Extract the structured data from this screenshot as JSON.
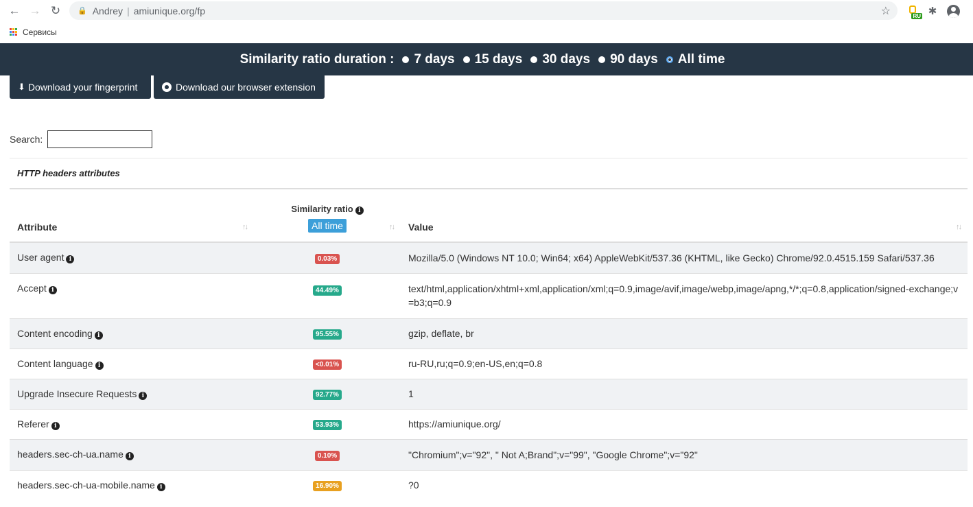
{
  "browser": {
    "profile": "Andrey",
    "url": "amiunique.org/fp",
    "bookmark_label": "Сервисы",
    "ext_badge": "RU"
  },
  "duration": {
    "title": "Similarity ratio duration :",
    "options": [
      {
        "label": "7 days",
        "selected": false
      },
      {
        "label": "15 days",
        "selected": false
      },
      {
        "label": "30 days",
        "selected": false
      },
      {
        "label": "90 days",
        "selected": false
      },
      {
        "label": "All time",
        "selected": true
      }
    ]
  },
  "buttons": {
    "download_fingerprint": "Download your fingerprint",
    "download_extension": "Download our browser extension"
  },
  "search": {
    "label": "Search:",
    "value": ""
  },
  "table": {
    "section_title": "HTTP headers attributes",
    "headers": {
      "attribute": "Attribute",
      "similarity": "Similarity ratio",
      "similarity_period": "All time",
      "value": "Value"
    },
    "rows": [
      {
        "attribute": "User agent",
        "ratio": "0.03%",
        "color": "#d9534f",
        "value": "Mozilla/5.0 (Windows NT 10.0; Win64; x64) AppleWebKit/537.36 (KHTML, like Gecko) Chrome/92.0.4515.159 Safari/537.36"
      },
      {
        "attribute": "Accept",
        "ratio": "44.49%",
        "color": "#26a98b",
        "value": "text/html,application/xhtml+xml,application/xml;q=0.9,image/avif,image/webp,image/apng,*/*;q=0.8,application/signed-exchange;v=b3;q=0.9"
      },
      {
        "attribute": "Content encoding",
        "ratio": "95.55%",
        "color": "#26a98b",
        "value": "gzip, deflate, br"
      },
      {
        "attribute": "Content language",
        "ratio": "<0.01%",
        "color": "#d9534f",
        "value": "ru-RU,ru;q=0.9;en-US,en;q=0.8"
      },
      {
        "attribute": "Upgrade Insecure Requests",
        "ratio": "92.77%",
        "color": "#26a98b",
        "value": "1"
      },
      {
        "attribute": "Referer",
        "ratio": "53.93%",
        "color": "#26a98b",
        "value": "https://amiunique.org/"
      },
      {
        "attribute": "headers.sec-ch-ua.name",
        "ratio": "0.10%",
        "color": "#d9534f",
        "value": "\"Chromium\";v=\"92\", \" Not A;Brand\";v=\"99\", \"Google Chrome\";v=\"92\""
      },
      {
        "attribute": "headers.sec-ch-ua-mobile.name",
        "ratio": "16.90%",
        "color": "#e8a020",
        "value": "?0"
      }
    ]
  }
}
